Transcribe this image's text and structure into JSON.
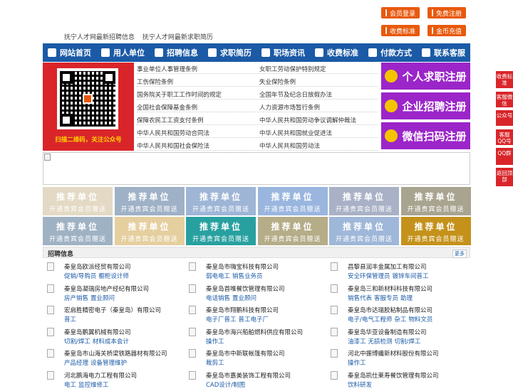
{
  "top_buttons": {
    "member_login": "会员登录",
    "free_register": "免费注册",
    "fee_standard": "收费标准",
    "gold_recharge": "金币充值"
  },
  "header_links": [
    "抚宁人才网最新招聘信息",
    "抚宁人才网最新求职简历"
  ],
  "nav": [
    {
      "label": "网站首页",
      "icon": "home-icon"
    },
    {
      "label": "用人单位",
      "icon": "building-icon"
    },
    {
      "label": "招聘信息",
      "icon": "megaphone-icon"
    },
    {
      "label": "求职简历",
      "icon": "resume-icon"
    },
    {
      "label": "职场资讯",
      "icon": "news-icon"
    },
    {
      "label": "收费标准",
      "icon": "yen-icon"
    },
    {
      "label": "付款方式",
      "icon": "wallet-icon"
    },
    {
      "label": "联系客服",
      "icon": "phone-icon"
    }
  ],
  "qr_caption": "扫描二维码，关注公众号",
  "policies": [
    "事业单位人事管理条例",
    "女职工劳动保护特别规定",
    "工伤保险条例",
    "失业保险条例",
    "国务院关于职工工作时间的规定",
    "全国年节及纪念日放假办法",
    "全国社会保障基金条例",
    "人力资源市场暂行条例",
    "保障农民工工资支付条例",
    "中华人民共和国劳动争议调解仲裁法",
    "中华人民共和国劳动合同法",
    "中华人民共和国就业促进法",
    "中华人民共和国社会保险法",
    "中华人民共和国劳动法"
  ],
  "register_buttons": [
    "个人求职注册",
    "企业招聘注册",
    "微信扫码注册"
  ],
  "recommend": {
    "title": "推荐单位",
    "subtitle": "开通贵宾会员赠送",
    "colors": [
      "#e3d9c4",
      "#9fb1c6",
      "#9eb5d6",
      "#9ab6df",
      "#a9b1c6",
      "#a8a490",
      "#9fb2c4",
      "#e5cf9f",
      "#29a0a0",
      "#b5ac88",
      "#9fb7d8",
      "#c4921b"
    ]
  },
  "jobs": {
    "title": "招聘信息",
    "more": "更多",
    "items": [
      {
        "company": "秦皇岛欧派经贸有限公司",
        "positions": [
          "促销/导购员",
          "橱柜设计师"
        ]
      },
      {
        "company": "秦皇岛市嗨宝科技有限公司",
        "positions": [
          "弱电电工",
          "销售业务员"
        ]
      },
      {
        "company": "昌黎县润丰金属加工有限公司",
        "positions": [
          "安全环保管理员",
          "镀锌车间普工"
        ]
      },
      {
        "company": "秦皇岛凝瑞房地产经纪有限公司",
        "positions": [
          "房产销售",
          "置业顾问"
        ]
      },
      {
        "company": "秦皇岛首唯餐饮管理有限公司",
        "positions": [
          "电话销售",
          "置业顾问"
        ]
      },
      {
        "company": "秦皇岛三和新材料科技有限公司",
        "positions": [
          "销售代表",
          "客服专员",
          "助理"
        ]
      },
      {
        "company": "宏启胜精密电子（秦皇岛）有限公司",
        "positions": [
          "普工"
        ]
      },
      {
        "company": "秦皇岛市翔鹏科技有限公司",
        "positions": [
          "电子厂普工",
          "普工电子厂"
        ]
      },
      {
        "company": "秦皇岛市达瑞胶粘制品有限公司",
        "positions": [
          "电子/电气工程师",
          "杂工",
          "物料文员"
        ]
      },
      {
        "company": "秦皇岛鹏翼机械有限公司",
        "positions": [
          "切割/焊工",
          "材料成本会计"
        ]
      },
      {
        "company": "秦皇岛市海兴船舶燃料供应有限公司",
        "positions": [
          "操作工"
        ]
      },
      {
        "company": "秦皇岛华亚设备制造有限公司",
        "positions": [
          "油漆工",
          "无损检测",
          "切割/焊工"
        ]
      },
      {
        "company": "秦皇岛市山海关桥梁铁路器材有限公司",
        "positions": [
          "产品经理",
          "设备管理维护"
        ]
      },
      {
        "company": "秦皇岛市中新联帐篷有限公司",
        "positions": [
          "裁剪工"
        ]
      },
      {
        "company": "河北中振博纖新材料股份有限公司",
        "positions": [
          "操作工"
        ]
      },
      {
        "company": "河北鹏海电力工程有限公司",
        "positions": [
          "电工",
          "监控维修工"
        ]
      },
      {
        "company": "秦皇岛市嘉美装饰工程有限公司",
        "positions": [
          "CAD设计/制图"
        ]
      },
      {
        "company": "秦皇岛凯仕莱寿餐饮管理有限公司",
        "positions": [
          "饮料研发"
        ]
      }
    ]
  },
  "side_float": [
    "收费标准",
    "客服微信",
    "公众号",
    "客服QQ号",
    "QQ群",
    "返回顶部"
  ]
}
